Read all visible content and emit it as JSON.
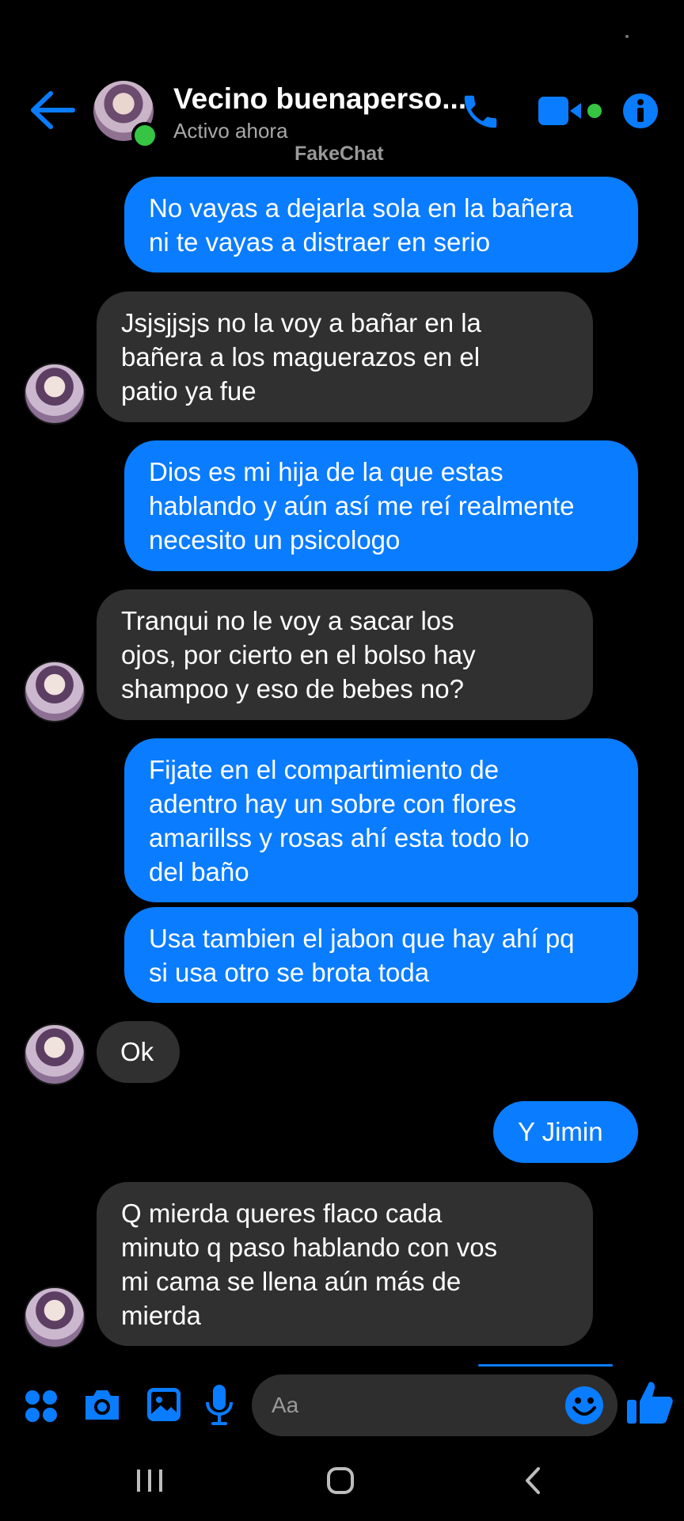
{
  "header": {
    "contact_name": "Vecino buenaperso...",
    "status": "Activo ahora",
    "watermark": "FakeChat",
    "icons": [
      "back-arrow-icon",
      "phone-icon",
      "video-camera-icon",
      "info-icon"
    ]
  },
  "messages": [
    {
      "from": "me",
      "lines": [
        "No vayas a dejarla sola en la bañera",
        "ni te vayas a distraer en serio"
      ]
    },
    {
      "from": "them",
      "lines": [
        "Jsjsjjsjs no la voy a bañar en la",
        "bañera a los maguerazos en el",
        "patio ya fue"
      ]
    },
    {
      "from": "me",
      "lines": [
        "Dios es mi hija de la que estas",
        "hablando y aún así me reí realmente",
        "necesito un psicologo"
      ]
    },
    {
      "from": "them",
      "lines": [
        "Tranqui no le voy a sacar los",
        "ojos, por cierto en el bolso hay",
        "shampoo y eso de bebes no?"
      ]
    },
    {
      "from": "me",
      "lines": [
        "Fijate en el compartimiento de",
        "adentro hay un sobre con flores",
        "amarillss y rosas ahí esta todo lo",
        "del baño"
      ]
    },
    {
      "from": "me",
      "lines": [
        "Usa tambien el jabon que hay ahí pq",
        "si usa otro se brota toda"
      ]
    },
    {
      "from": "them",
      "lines": [
        "Ok"
      ]
    },
    {
      "from": "me",
      "lines": [
        "Y Jimin"
      ]
    },
    {
      "from": "them",
      "lines": [
        "Q mierda queres flaco cada",
        "minuto q paso hablando con vos",
        "mi cama se llena aún más de",
        "mierda"
      ]
    }
  ],
  "composer": {
    "placeholder": "Aa",
    "icons": [
      "apps-icon",
      "camera-icon",
      "gallery-icon",
      "microphone-icon",
      "emoji-icon",
      "thumbs-up-icon"
    ]
  },
  "colors": {
    "accent": "#0a7cff",
    "received_bubble": "#303030",
    "online": "#36c443",
    "background": "#000000"
  }
}
